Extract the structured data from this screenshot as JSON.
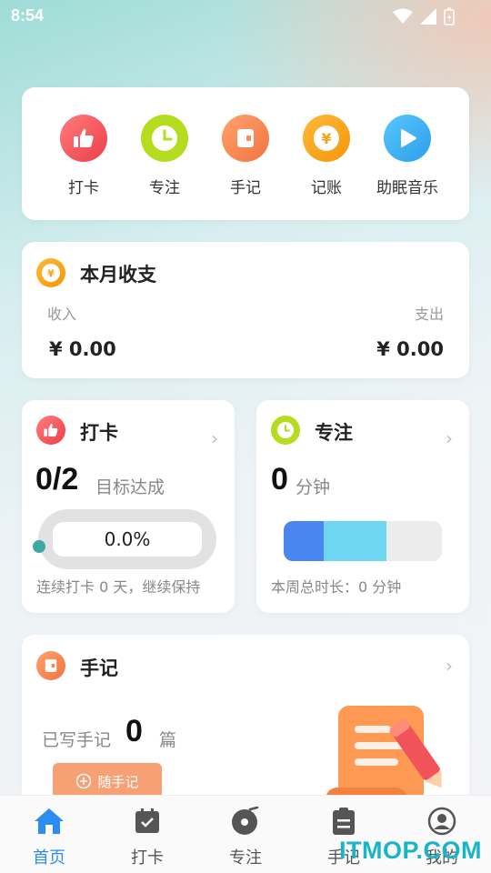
{
  "status_bar": {
    "time": "8:54"
  },
  "quick_actions": [
    {
      "label": "打卡",
      "icon": "thumbs-up-icon",
      "color": "#f0535a"
    },
    {
      "label": "专注",
      "icon": "clock-icon",
      "color": "#b5dc1e"
    },
    {
      "label": "手记",
      "icon": "notebook-icon",
      "color": "#f78a56"
    },
    {
      "label": "记账",
      "icon": "yen-coin-icon",
      "color": "#f8a21b"
    },
    {
      "label": "助眠音乐",
      "icon": "play-icon",
      "color": "#3bb0f0"
    }
  ],
  "monthly": {
    "title": "本月收支",
    "income_label": "收入",
    "income_value": "¥ 0.00",
    "expense_label": "支出",
    "expense_value": "¥ 0.00"
  },
  "checkin": {
    "title": "打卡",
    "count": "0/2",
    "target_label": "目标达成",
    "percent_text": "0.0%",
    "progress": 0,
    "footer": "连续打卡 0 天，继续保持"
  },
  "focus": {
    "title": "专注",
    "minutes": "0",
    "unit": "分钟",
    "footer": "本周总时长：0 分钟"
  },
  "notes": {
    "title": "手记",
    "written_label": "已写手记",
    "count": "0",
    "unit": "篇",
    "button_label": "随手记"
  },
  "bottom_nav": [
    {
      "label": "首页",
      "icon": "home-icon",
      "active": true
    },
    {
      "label": "打卡",
      "icon": "calendar-check-icon",
      "active": false
    },
    {
      "label": "专注",
      "icon": "vinyl-disc-icon",
      "active": false
    },
    {
      "label": "手记",
      "icon": "notebook-list-icon",
      "active": false
    },
    {
      "label": "我的",
      "icon": "profile-icon",
      "active": false
    }
  ],
  "watermark": "ITMOP.COM",
  "colors": {
    "accent_blue": "#2d8cf0",
    "bar_blue": "#4a86f0",
    "bar_cyan": "#6fd6f2"
  }
}
